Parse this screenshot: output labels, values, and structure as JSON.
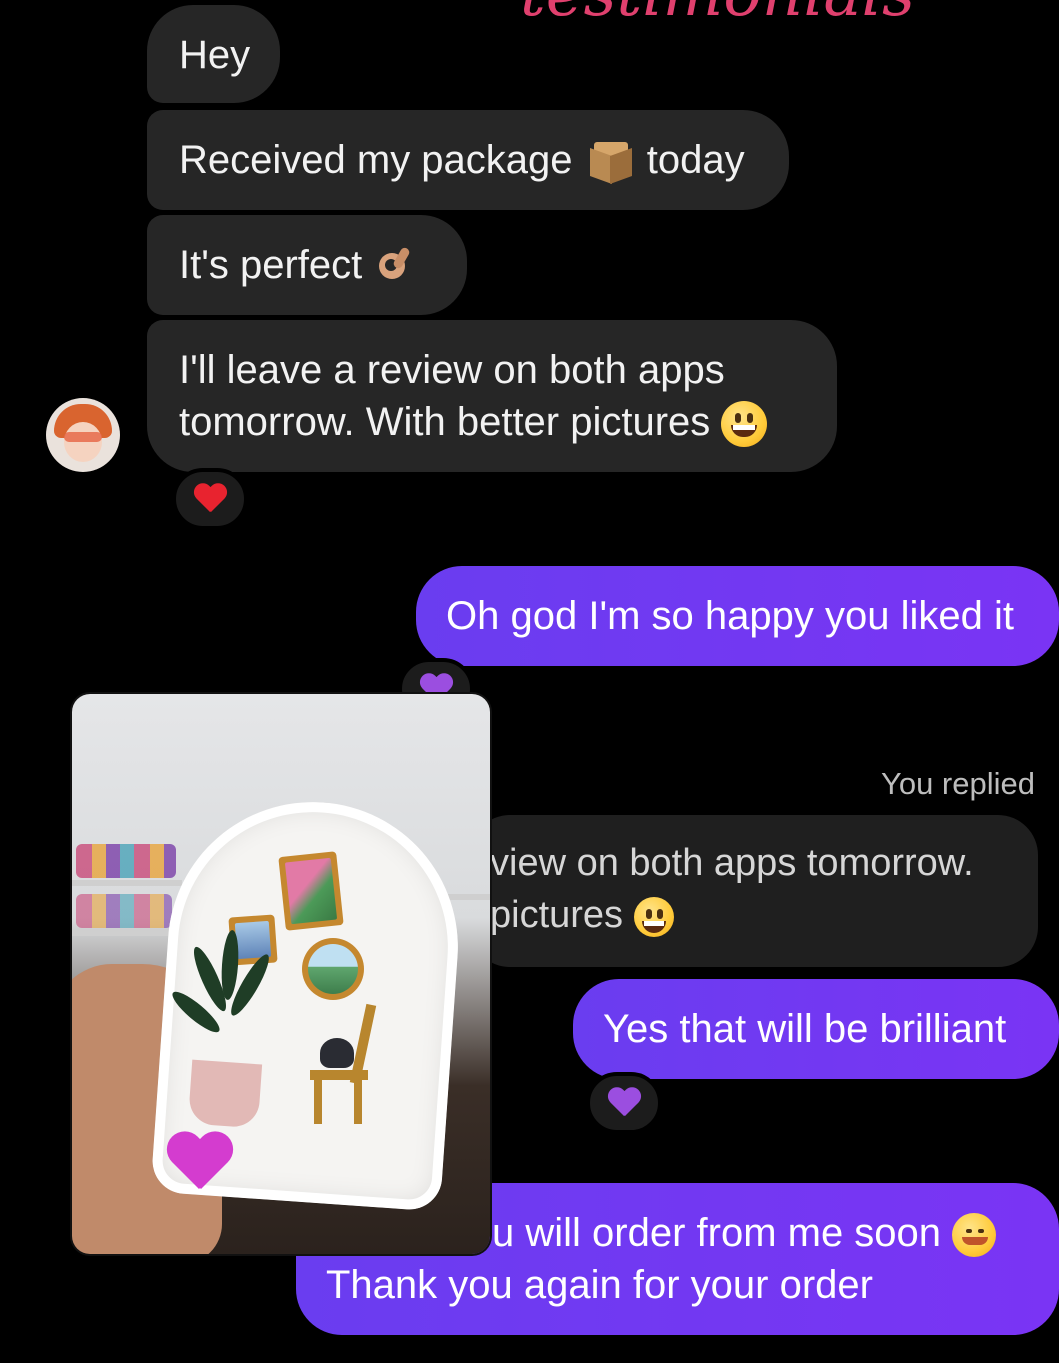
{
  "header": {
    "script_text": "testimonials"
  },
  "incoming": {
    "messages": [
      {
        "text": "Hey"
      },
      {
        "text_before": "Received my package",
        "text_after": "today"
      },
      {
        "text": "It's perfect"
      },
      {
        "line1": "I'll leave a review on both apps",
        "line2": "tomorrow. With better pictures"
      }
    ],
    "reaction_emoji": "red-heart"
  },
  "outgoing": {
    "msg1": "Oh god I'm so happy you liked it",
    "msg1_reaction": "purple-heart",
    "replied_label": "You replied",
    "quoted_line1": "view on both apps tomorrow.",
    "quoted_line2": "pictures",
    "msg2": "Yes that will be brilliant",
    "msg2_reaction": "purple-heart",
    "msg3_line1": "u will order from me soon",
    "msg3_line2": "Thank you again for your order"
  },
  "colors": {
    "background": "#000000",
    "incoming_bubble": "#262626",
    "outgoing_bubble": "#6a3df0",
    "text": "#f2f2f2",
    "meta_text": "#bdbdbd",
    "heart_red": "#e8232f",
    "heart_purple": "#9b4ee0"
  }
}
